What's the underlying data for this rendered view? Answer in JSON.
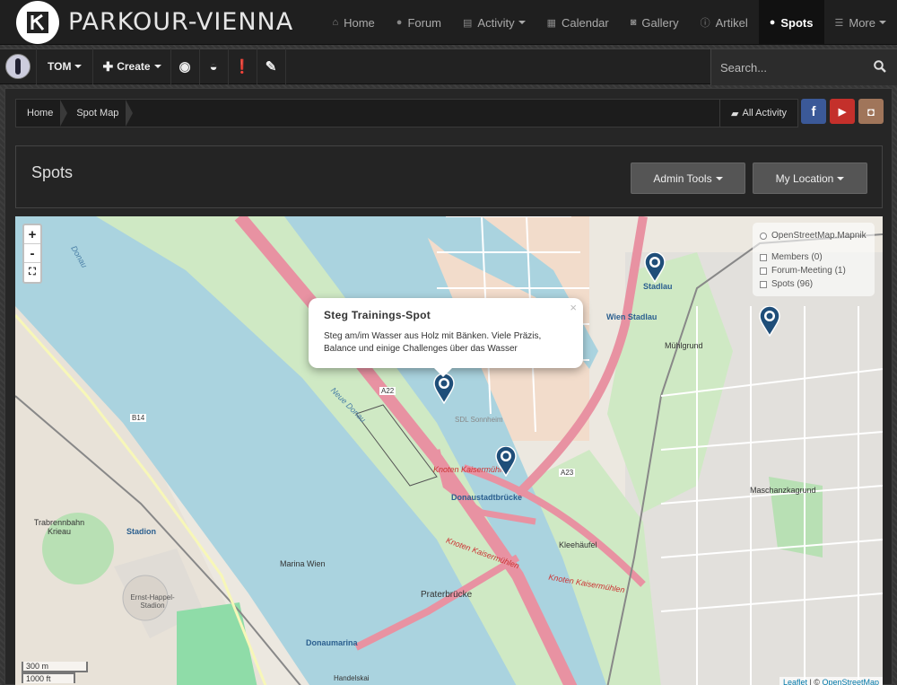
{
  "site": {
    "brand": "PARKOUR-VIENNA"
  },
  "nav": {
    "items": [
      {
        "label": "Home",
        "icon": "home-icon",
        "glyph": "⌂"
      },
      {
        "label": "Forum",
        "icon": "comments-icon",
        "glyph": "●"
      },
      {
        "label": "Activity",
        "icon": "file-icon",
        "glyph": "▤"
      },
      {
        "label": "Calendar",
        "icon": "calendar-icon",
        "glyph": "▦"
      },
      {
        "label": "Gallery",
        "icon": "camera-icon",
        "glyph": "◙"
      },
      {
        "label": "Artikel",
        "icon": "info-icon",
        "glyph": "ⓘ"
      },
      {
        "label": "Spots",
        "icon": "map-marker-icon",
        "glyph": "●"
      },
      {
        "label": "More",
        "icon": "menu-icon",
        "glyph": "☰"
      }
    ]
  },
  "userbar": {
    "username": "TOM",
    "create_label": "Create",
    "search_placeholder": "Search..."
  },
  "breadcrumb": {
    "items": [
      "Home",
      "Spot Map"
    ],
    "all_activity": "All Activity"
  },
  "social": {
    "facebook": "f",
    "youtube": "▶",
    "instagram": "◘"
  },
  "page": {
    "title": "Spots",
    "admin_tools": "Admin Tools",
    "my_location": "My Location"
  },
  "map": {
    "zoom_in": "+",
    "zoom_out": "-",
    "fullscreen": "⛶",
    "layers": {
      "base": "OpenStreetMap.Mapnik",
      "overlays": [
        "Members (0)",
        "Forum-Meeting (1)",
        "Spots (96)"
      ]
    },
    "popup": {
      "title": "Steg Trainings-Spot",
      "description": "Steg am/im Wasser aus Holz mit Bänken. Viele Präzis, Balance und einige Challenges über das Wasser",
      "close": "×"
    },
    "scale": [
      "300 m",
      "1000 ft"
    ],
    "attribution_leaflet": "Leaflet",
    "attribution_sep": " | © ",
    "attribution_osm": "OpenStreetMap",
    "labels": {
      "donaustadtbruecke": "Donaustadtbrücke",
      "praterbruecke": "Praterbrücke",
      "kleehaeufel": "Kleehäufel",
      "kaiserm1": "Knoten Kaisermühlen",
      "kaiserm2": "Knoten Kaisermühlen",
      "kaiserm3": "Knoten Kaisermühlen",
      "muehlgrund": "Mühlgrund",
      "stadlau": "Stadlau",
      "wien_stadlau": "Wien Stadlau",
      "maschanzka": "Maschanzkagrund",
      "marina": "Marina Wien",
      "donaumarina": "Donaumarina",
      "stadion": "Stadion",
      "trabrennbahn": "Trabrennbahn Krieau",
      "ernst": "Ernst-Happel-Stadion",
      "donau": "Donau",
      "neue_donau": "Neue Donau",
      "a22": "A22",
      "a23": "A23",
      "b14": "B14",
      "sdl": "SDL Sonnheim",
      "handelskai": "Handelskai"
    }
  },
  "colors": {
    "water": "#aad3df",
    "park": "#c8facc",
    "residential": "#e0dfdf",
    "motorway": "#e892a2",
    "marker": "#1f4e79"
  }
}
